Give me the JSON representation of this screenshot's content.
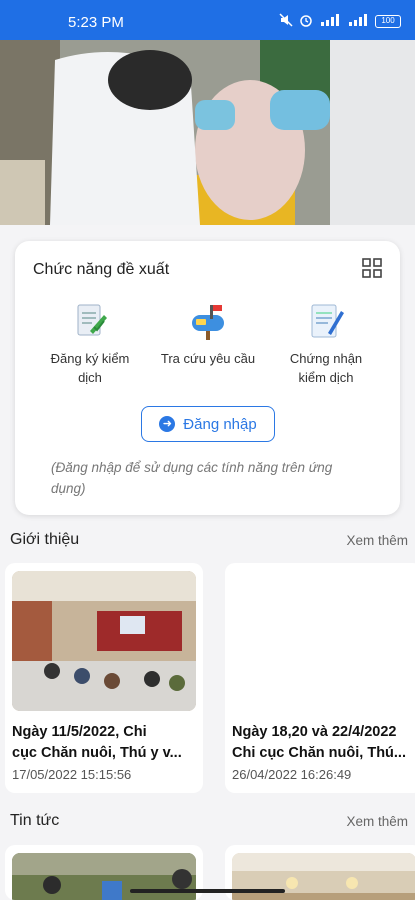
{
  "status_bar": {
    "time": "5:23 PM",
    "icons": [
      "mute-icon",
      "alarm-icon",
      "4g-signal-icon",
      "4g-signal-icon"
    ],
    "battery": "100"
  },
  "suggested": {
    "title": "Chức năng đề xuất",
    "features": [
      {
        "label_line1": "Đăng ký kiểm",
        "label_line2": "dịch",
        "icon": "register-document-icon"
      },
      {
        "label_line1": "Tra cứu yêu cầu",
        "label_line2": "",
        "icon": "mailbox-icon"
      },
      {
        "label_line1": "Chứng nhận",
        "label_line2": "kiểm dịch",
        "icon": "certificate-icon"
      }
    ],
    "login_label": "Đăng nhập",
    "note_line1": "(Đăng nhập để sử dụng các tính năng trên ứng",
    "note_line2": "dụng)"
  },
  "intro": {
    "title": "Giới thiệu",
    "more": "Xem thêm",
    "items": [
      {
        "title_line1": "Ngày 11/5/2022, Chi",
        "title_line2": "cục Chăn nuôi, Thú y v...",
        "date": "17/05/2022 15:15:56"
      },
      {
        "title_line1": "Ngày 18,20 và 22/4/2022",
        "title_line2": "Chi cục Chăn nuôi, Thú...",
        "date": "26/04/2022 16:26:49"
      }
    ]
  },
  "news": {
    "title": "Tin tức",
    "more": "Xem thêm"
  },
  "colors": {
    "primary": "#1f6fe5",
    "accent": "#2b78e4",
    "background": "#f4f4f6"
  }
}
